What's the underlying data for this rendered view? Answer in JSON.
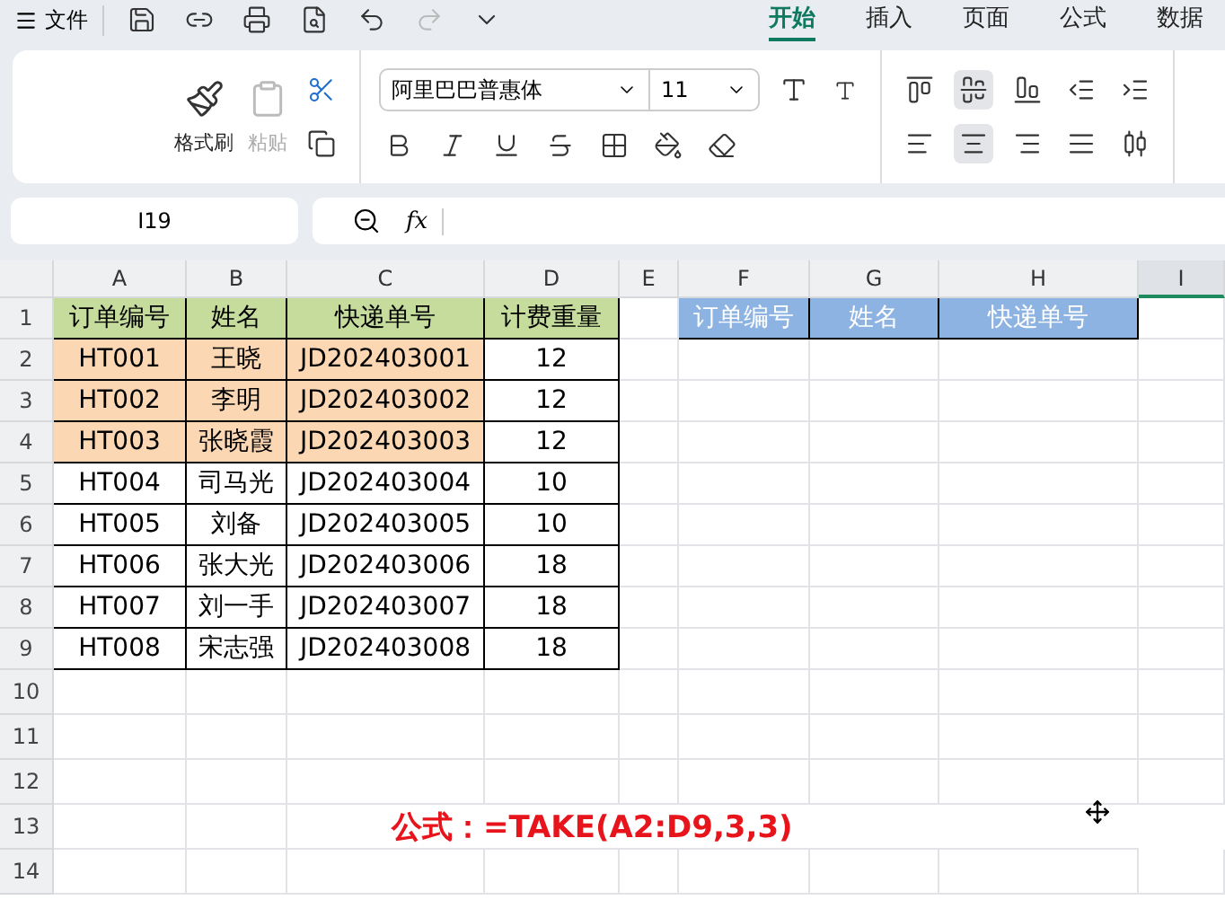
{
  "menu": {
    "label": "文件"
  },
  "tabs": [
    {
      "label": "开始",
      "selected": true
    },
    {
      "label": "插入",
      "selected": false
    },
    {
      "label": "页面",
      "selected": false
    },
    {
      "label": "公式",
      "selected": false
    },
    {
      "label": "数据",
      "selected": false
    }
  ],
  "clipboard": {
    "format_painter": "格式刷",
    "paste": "粘贴"
  },
  "font": {
    "name": "阿里巴巴普惠体",
    "size": "11"
  },
  "align_top": [
    {
      "kind": "top",
      "selected": false
    },
    {
      "kind": "middle",
      "selected": true
    },
    {
      "kind": "bottom",
      "selected": false
    },
    {
      "kind": "outdent",
      "selected": false
    },
    {
      "kind": "indent",
      "selected": false
    }
  ],
  "align_bottom": [
    {
      "kind": "left",
      "selected": false
    },
    {
      "kind": "center",
      "selected": true
    },
    {
      "kind": "right",
      "selected": false
    },
    {
      "kind": "justify",
      "selected": false
    },
    {
      "kind": "distribute",
      "selected": false
    }
  ],
  "name_box": "I19",
  "fx_label": "fx",
  "columns": [
    {
      "label": "A",
      "selected": false
    },
    {
      "label": "B",
      "selected": false
    },
    {
      "label": "C",
      "selected": false
    },
    {
      "label": "D",
      "selected": false
    },
    {
      "label": "E",
      "selected": false
    },
    {
      "label": "F",
      "selected": false
    },
    {
      "label": "G",
      "selected": false
    },
    {
      "label": "H",
      "selected": false
    },
    {
      "label": "I",
      "selected": true
    }
  ],
  "header_row": {
    "number": "1",
    "cells": [
      "订单编号",
      "姓名",
      "快递单号",
      "计费重量"
    ],
    "result_headers": [
      "订单编号",
      "姓名",
      "快递单号"
    ]
  },
  "rows": [
    {
      "number": "2",
      "highlighted": true,
      "cells": [
        "HT001",
        "王晓",
        "JD202403001",
        "12"
      ]
    },
    {
      "number": "3",
      "highlighted": true,
      "cells": [
        "HT002",
        "李明",
        "JD202403002",
        "12"
      ]
    },
    {
      "number": "4",
      "highlighted": true,
      "cells": [
        "HT003",
        "张晓霞",
        "JD202403003",
        "12"
      ]
    },
    {
      "number": "5",
      "highlighted": false,
      "cells": [
        "HT004",
        "司马光",
        "JD202403004",
        "10"
      ]
    },
    {
      "number": "6",
      "highlighted": false,
      "cells": [
        "HT005",
        "刘备",
        "JD202403005",
        "10"
      ]
    },
    {
      "number": "7",
      "highlighted": false,
      "cells": [
        "HT006",
        "张大光",
        "JD202403006",
        "18"
      ]
    },
    {
      "number": "8",
      "highlighted": false,
      "cells": [
        "HT007",
        "刘一手",
        "JD202403007",
        "18"
      ]
    },
    {
      "number": "9",
      "highlighted": false,
      "cells": [
        "HT008",
        "宋志强",
        "JD202403008",
        "18"
      ]
    }
  ],
  "empty_rows": [
    {
      "number": "10"
    },
    {
      "number": "11"
    },
    {
      "number": "12"
    },
    {
      "number": "13",
      "annotation": "公式：=TAKE(A2:D9,3,3)"
    },
    {
      "number": "14"
    }
  ]
}
